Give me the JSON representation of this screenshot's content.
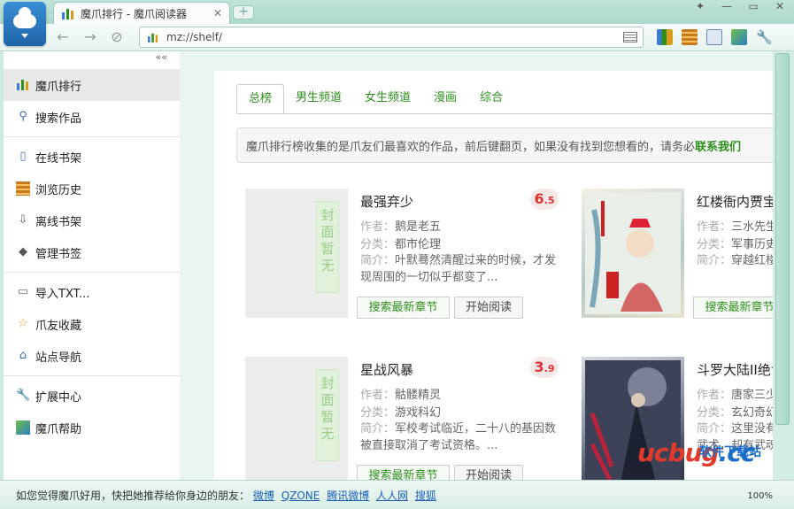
{
  "window": {
    "tab_title": "魔爪排行 - 魔爪阅读器"
  },
  "toolbar": {
    "address": "mz://shelf/"
  },
  "sidebar": {
    "collapse": "««",
    "items": [
      {
        "label": "魔爪排行",
        "icon": "chart-icon"
      },
      {
        "label": "搜索作品",
        "icon": "search-icon"
      },
      {
        "label": "在线书架",
        "icon": "book-icon"
      },
      {
        "label": "浏览历史",
        "icon": "history-icon"
      },
      {
        "label": "离线书架",
        "icon": "download-icon"
      },
      {
        "label": "管理书签",
        "icon": "bookmark-icon"
      },
      {
        "label": "导入TXT...",
        "icon": "file-icon"
      },
      {
        "label": "爪友收藏",
        "icon": "star-icon"
      },
      {
        "label": "站点导航",
        "icon": "home-icon"
      },
      {
        "label": "扩展中心",
        "icon": "wrench-icon"
      },
      {
        "label": "魔爪帮助",
        "icon": "help-icon"
      }
    ]
  },
  "content": {
    "tabs": [
      "总榜",
      "男生频道",
      "女生频道",
      "漫画",
      "综合"
    ],
    "notice": "魔爪排行榜收集的是爪友们最喜欢的作品，前后键翻页，如果没有找到您想看的，请务必",
    "notice_link": "联系我们",
    "books": [
      {
        "title": "最强弃少",
        "score_int": "6",
        "score_dec": ".5",
        "author_label": "作者：",
        "author": "鹅是老五",
        "cat_label": "分类：",
        "cat": "都市伦理",
        "desc_label": "简介：",
        "desc": "叶默蓦然清醒过来的时候，才发现周围的一切似乎都变了...",
        "cover_placeholder": "封面暂无",
        "btn_search": "搜索最新章节",
        "btn_read": "开始阅读"
      },
      {
        "title": "红楼衙内贾宝玉",
        "author_label": "作者：",
        "author": "三水先生",
        "cat_label": "分类：",
        "cat": "军事历史",
        "desc_label": "简介：",
        "desc": "穿越红楼的贾宝玉，不可...",
        "btn_search": "搜索最新章节"
      },
      {
        "title": "星战风暴",
        "score_int": "3",
        "score_dec": ".9",
        "author_label": "作者：",
        "author": "骷髅精灵",
        "cat_label": "分类：",
        "cat": "游戏科幻",
        "desc_label": "简介：",
        "desc": "军校考试临近，二十八的基因数被直接取消了考试资格。...",
        "cover_placeholder": "封面暂无",
        "btn_search": "搜索最新章节",
        "btn_read": "开始阅读"
      },
      {
        "title": "斗罗大陆II绝世唐门",
        "author_label": "作者：",
        "author": "唐家三少",
        "cat_label": "分类：",
        "cat": "玄幻奇幻",
        "desc_label": "简介：",
        "desc": "这里没有魔法，没有斗气，没有武术，却有武魂..."
      }
    ]
  },
  "status": {
    "text": "如您觉得魔爪好用，快把她推荐给你身边的朋友：",
    "links": [
      "微博",
      "QZONE",
      "腾讯微博",
      "人人网",
      "搜狐"
    ],
    "zoom": "100%"
  },
  "watermark": {
    "logo": "ucbug",
    "tld": ".cc",
    "cn": "软件下载站"
  }
}
